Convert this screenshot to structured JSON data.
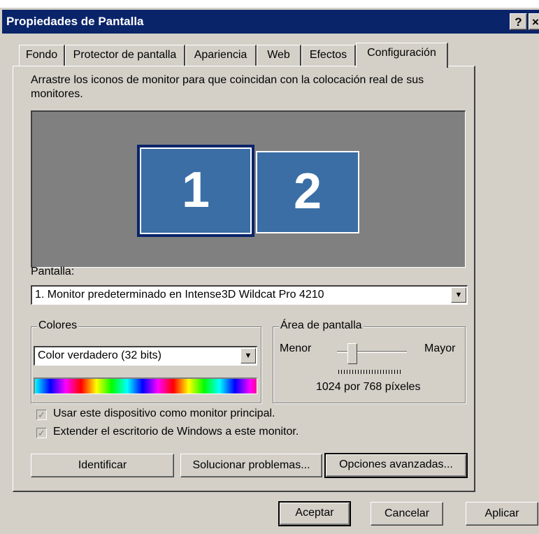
{
  "window": {
    "title": "Propiedades de Pantalla",
    "help_button": "?",
    "close_button": "×"
  },
  "tabs": [
    {
      "label": "Fondo",
      "active": false
    },
    {
      "label": "Protector de pantalla",
      "active": false
    },
    {
      "label": "Apariencia",
      "active": false
    },
    {
      "label": "Web",
      "active": false
    },
    {
      "label": "Efectos",
      "active": false
    },
    {
      "label": "Configuración",
      "active": true
    }
  ],
  "settings": {
    "instructions": "Arrastre los iconos de monitor para que coincidan con la colocación real de sus monitores.",
    "monitors": [
      {
        "label": "1",
        "selected": true
      },
      {
        "label": "2",
        "selected": false
      }
    ],
    "display_label": "Pantalla:",
    "display_value": "1. Monitor predeterminado en Intense3D Wildcat Pro 4210",
    "colors": {
      "group_title": "Colores",
      "value": "Color verdadero (32 bits)"
    },
    "screen_area": {
      "group_title": "Área de pantalla",
      "min_label": "Menor",
      "max_label": "Mayor",
      "resolution_text": "1024 por 768 píxeles",
      "slider_level": 0.2
    },
    "primary_monitor": {
      "label": "Usar este dispositivo como monitor principal.",
      "checked": true,
      "disabled": true
    },
    "extend_desktop": {
      "label": "Extender el escritorio de Windows a este monitor.",
      "checked": true,
      "disabled": true
    },
    "buttons": {
      "identify": "Identificar",
      "troubleshoot": "Solucionar problemas...",
      "advanced": "Opciones avanzadas..."
    }
  },
  "dialog_buttons": {
    "ok": "Aceptar",
    "cancel": "Cancelar",
    "apply": "Aplicar"
  },
  "colors": {
    "titlebar": "#0a246a",
    "face": "#d4d0c8",
    "monitor": "#3a6ea5",
    "preview_bg": "#808080"
  }
}
